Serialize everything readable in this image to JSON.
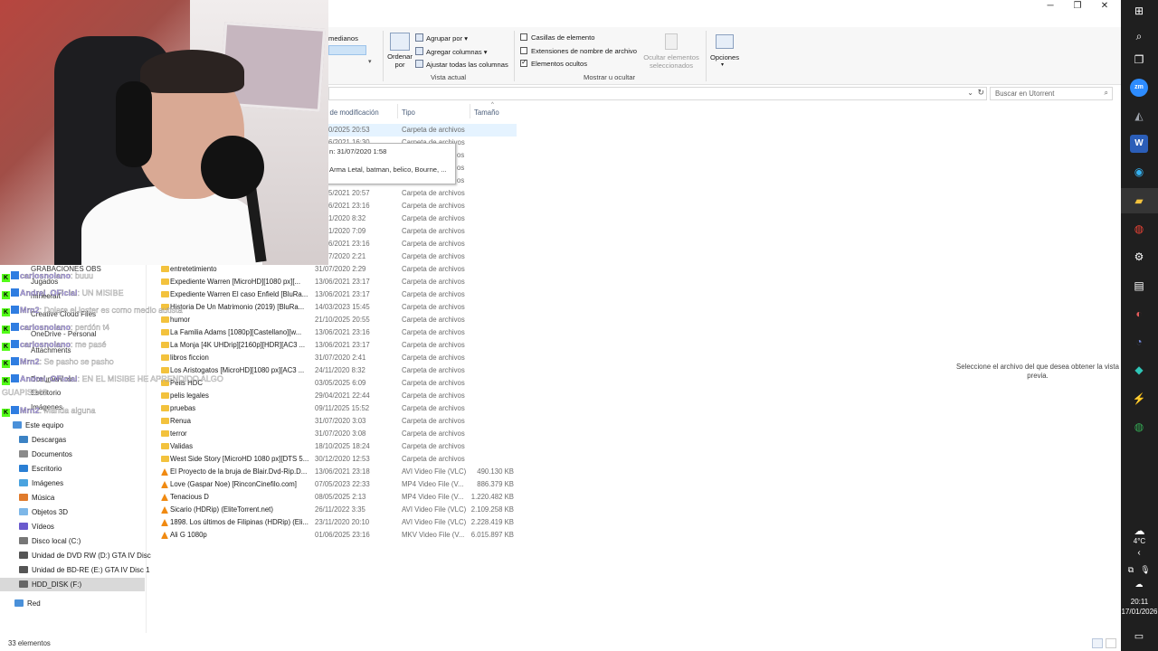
{
  "window": {
    "minimize": "─",
    "restore": "❐",
    "close": "✕"
  },
  "ribbon": {
    "layout_partial": "medianos",
    "sort_by": "Ordenar por",
    "group_by": "Agrupar por",
    "add_columns": "Agregar columnas",
    "fit_columns": "Ajustar todas las columnas",
    "current_view": "Vista actual",
    "item_checkboxes": "Casillas de elemento",
    "file_extensions": "Extensiones de nombre de archivo",
    "hidden_items": "Elementos ocultos",
    "hide_selected": "Ocultar elementos seleccionados",
    "options": "Opciones",
    "show_hide": "Mostrar u ocultar"
  },
  "search": {
    "placeholder": "Buscar en Utorrent"
  },
  "columns": {
    "date": "a de modificación",
    "type": "Tipo",
    "size": "Tamaño"
  },
  "tooltip": {
    "line1": "n: 31/07/2020 1:58",
    "line2": "Arma Letal, batman, belico, Bourne, ..."
  },
  "partial_rows": [
    {
      "date": "0/2025 20:53",
      "type": "Carpeta de archivos"
    },
    {
      "date": "6/2021 16:30",
      "type": "Carpeta de archivos"
    },
    {
      "date": "",
      "type": "os"
    },
    {
      "date": "",
      "type": "os"
    },
    {
      "date": "",
      "type": "os"
    },
    {
      "date": "5/2021 20:57",
      "type": "Carpeta de archivos"
    },
    {
      "date": "6/2021 23:16",
      "type": "Carpeta de archivos"
    },
    {
      "date": "1/2020 8:32",
      "type": "Carpeta de archivos"
    },
    {
      "date": "1/2020 7:09",
      "type": "Carpeta de archivos"
    },
    {
      "date": "6/2021 23:16",
      "type": "Carpeta de archivos"
    },
    {
      "date": "7/2020 2:21",
      "type": "Carpeta de archivos"
    }
  ],
  "files": [
    {
      "name": "entretetimiento",
      "date": "31/07/2020 2:29",
      "type": "Carpeta de archivos",
      "size": "",
      "kind": "folder"
    },
    {
      "name": "Expediente Warren [MicroHD][1080 px][...",
      "date": "13/06/2021 23:17",
      "type": "Carpeta de archivos",
      "size": "",
      "kind": "folder"
    },
    {
      "name": "Expediente Warren El caso Enfield [BluRa...",
      "date": "13/06/2021 23:17",
      "type": "Carpeta de archivos",
      "size": "",
      "kind": "folder"
    },
    {
      "name": "Historia De Un Matrimonio (2019) [BluRa...",
      "date": "14/03/2023 15:45",
      "type": "Carpeta de archivos",
      "size": "",
      "kind": "folder"
    },
    {
      "name": "humor",
      "date": "21/10/2025 20:55",
      "type": "Carpeta de archivos",
      "size": "",
      "kind": "folder"
    },
    {
      "name": "La Familia Adams [1080p][Castellano][w...",
      "date": "13/06/2021 23:16",
      "type": "Carpeta de archivos",
      "size": "",
      "kind": "folder"
    },
    {
      "name": "La Monja [4K UHDrip][2160p][HDR][AC3 ...",
      "date": "13/06/2021 23:17",
      "type": "Carpeta de archivos",
      "size": "",
      "kind": "folder"
    },
    {
      "name": "libros ficcion",
      "date": "31/07/2020 2:41",
      "type": "Carpeta de archivos",
      "size": "",
      "kind": "folder"
    },
    {
      "name": "Los Aristogatos [MicroHD][1080 px][AC3 ...",
      "date": "24/11/2020 8:32",
      "type": "Carpeta de archivos",
      "size": "",
      "kind": "folder"
    },
    {
      "name": "Pelis HDC",
      "date": "03/05/2025 6:09",
      "type": "Carpeta de archivos",
      "size": "",
      "kind": "folder"
    },
    {
      "name": "pelis legales",
      "date": "29/04/2021 22:44",
      "type": "Carpeta de archivos",
      "size": "",
      "kind": "folder"
    },
    {
      "name": "pruebas",
      "date": "09/11/2025 15:52",
      "type": "Carpeta de archivos",
      "size": "",
      "kind": "folder"
    },
    {
      "name": "Renua",
      "date": "31/07/2020 3:03",
      "type": "Carpeta de archivos",
      "size": "",
      "kind": "folder"
    },
    {
      "name": "terror",
      "date": "31/07/2020 3:08",
      "type": "Carpeta de archivos",
      "size": "",
      "kind": "folder"
    },
    {
      "name": "Validas",
      "date": "18/10/2025 18:24",
      "type": "Carpeta de archivos",
      "size": "",
      "kind": "folder"
    },
    {
      "name": "West Side Story [MicroHD 1080 px][DTS 5...",
      "date": "30/12/2020 12:53",
      "type": "Carpeta de archivos",
      "size": "",
      "kind": "folder"
    },
    {
      "name": "El Proyecto de la bruja de Blair.Dvd-Rip.D...",
      "date": "13/06/2021 23:18",
      "type": "AVI Video File (VLC)",
      "size": "490.130 KB",
      "kind": "vlc"
    },
    {
      "name": "Love (Gaspar Noe) [RinconCinefilo.com]",
      "date": "07/05/2023 22:33",
      "type": "MP4 Video File (V...",
      "size": "886.379 KB",
      "kind": "vlc"
    },
    {
      "name": "Tenacious D",
      "date": "08/05/2025 2:13",
      "type": "MP4 Video File (V...",
      "size": "1.220.482 KB",
      "kind": "vlc"
    },
    {
      "name": "Sicario (HDRip) (EliteTorrent.net)",
      "date": "26/11/2022 3:35",
      "type": "AVI Video File (VLC)",
      "size": "2.109.258 KB",
      "kind": "vlc"
    },
    {
      "name": "1898. Los últimos de Filipinas (HDRip) (Eli...",
      "date": "23/11/2020 20:10",
      "type": "AVI Video File (VLC)",
      "size": "2.228.419 KB",
      "kind": "vlc"
    },
    {
      "name": "Ali G 1080p",
      "date": "01/06/2025 23:16",
      "type": "MKV Video File (V...",
      "size": "6.015.897 KB",
      "kind": "vlc"
    }
  ],
  "nav": {
    "partial_items": [
      "GRABACIONES OBS",
      "Jugados",
      "minecraft",
      "Creative Cloud Files",
      "OneDrive - Personal",
      "Attachments",
      "Documentos",
      "Escritorio",
      "Imágenes"
    ],
    "this_pc": "Este equipo",
    "items": [
      "Descargas",
      "Documentos",
      "Escritorio",
      "Imágenes",
      "Música",
      "Objetos 3D",
      "Vídeos",
      "Disco local (C:)",
      "Unidad de DVD RW (D:) GTA IV Disc",
      "Unidad de BD-RE (E:) GTA IV Disc 1",
      "HDD_DISK (F:)"
    ],
    "network": "Red"
  },
  "preview_message": "Seleccione el archivo del que desea obtener la vista previa.",
  "status": {
    "count": "33 elementos"
  },
  "chat": [
    {
      "user": "carlosnolano",
      "msg": ": buuu"
    },
    {
      "user": "Andrei_OFicial",
      "msg": ": UN MISIBE"
    },
    {
      "user": "Mrn2",
      "msg": ": Dolare el loster es como medio autista"
    },
    {
      "user": "carlosnolano",
      "msg": ": perdón t4"
    },
    {
      "user": "carlosnolano",
      "msg": ": me pasé"
    },
    {
      "user": "Mrn2",
      "msg": ": Se pasho se pasho"
    },
    {
      "user": "Andrei_OFicial",
      "msg": ": EN EL MISIBE HE APRENDIDO ALGO"
    },
    {
      "user": "",
      "msg": "GUAPISIMO"
    },
    {
      "user": "Mrn2",
      "msg": ": Manda alguna"
    }
  ],
  "taskbar": {
    "weather_temp": "4°C",
    "time": "20:11",
    "date": "17/01/2026"
  },
  "colors": {
    "accent": "#0078d4",
    "folder": "#f3c23d",
    "vlc": "#f08a12",
    "chat_badge": "#53fc18",
    "taskbar": "#1f1f1f"
  }
}
